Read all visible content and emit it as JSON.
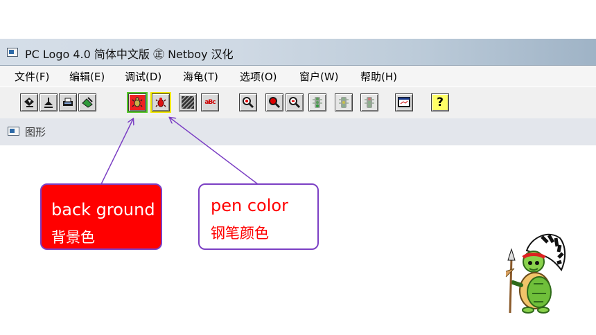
{
  "window": {
    "title": "PC Logo 4.0 简体中文版  ㊣ Netboy  汉化"
  },
  "menu": [
    {
      "label": "文件(F)"
    },
    {
      "label": "编辑(E)"
    },
    {
      "label": "调试(D)"
    },
    {
      "label": "海龟(T)"
    },
    {
      "label": "选项(O)"
    },
    {
      "label": "窗户(W)"
    },
    {
      "label": "帮助(H)"
    }
  ],
  "toolbar": {
    "help_glyph": "?",
    "text_glyph": "aBc"
  },
  "child_window": {
    "title": "图形"
  },
  "callouts": {
    "background": {
      "line1": "back ground",
      "line2": "背景色"
    },
    "pen": {
      "line1": "pen color",
      "line2": "钢笔颜色"
    }
  },
  "colors": {
    "background_callout": "#ff0000",
    "pen_text": "#ff0000",
    "callout_border": "#7b3fc4",
    "highlight_background_button": "#55c82a",
    "highlight_pen_button": "#f2e800"
  }
}
